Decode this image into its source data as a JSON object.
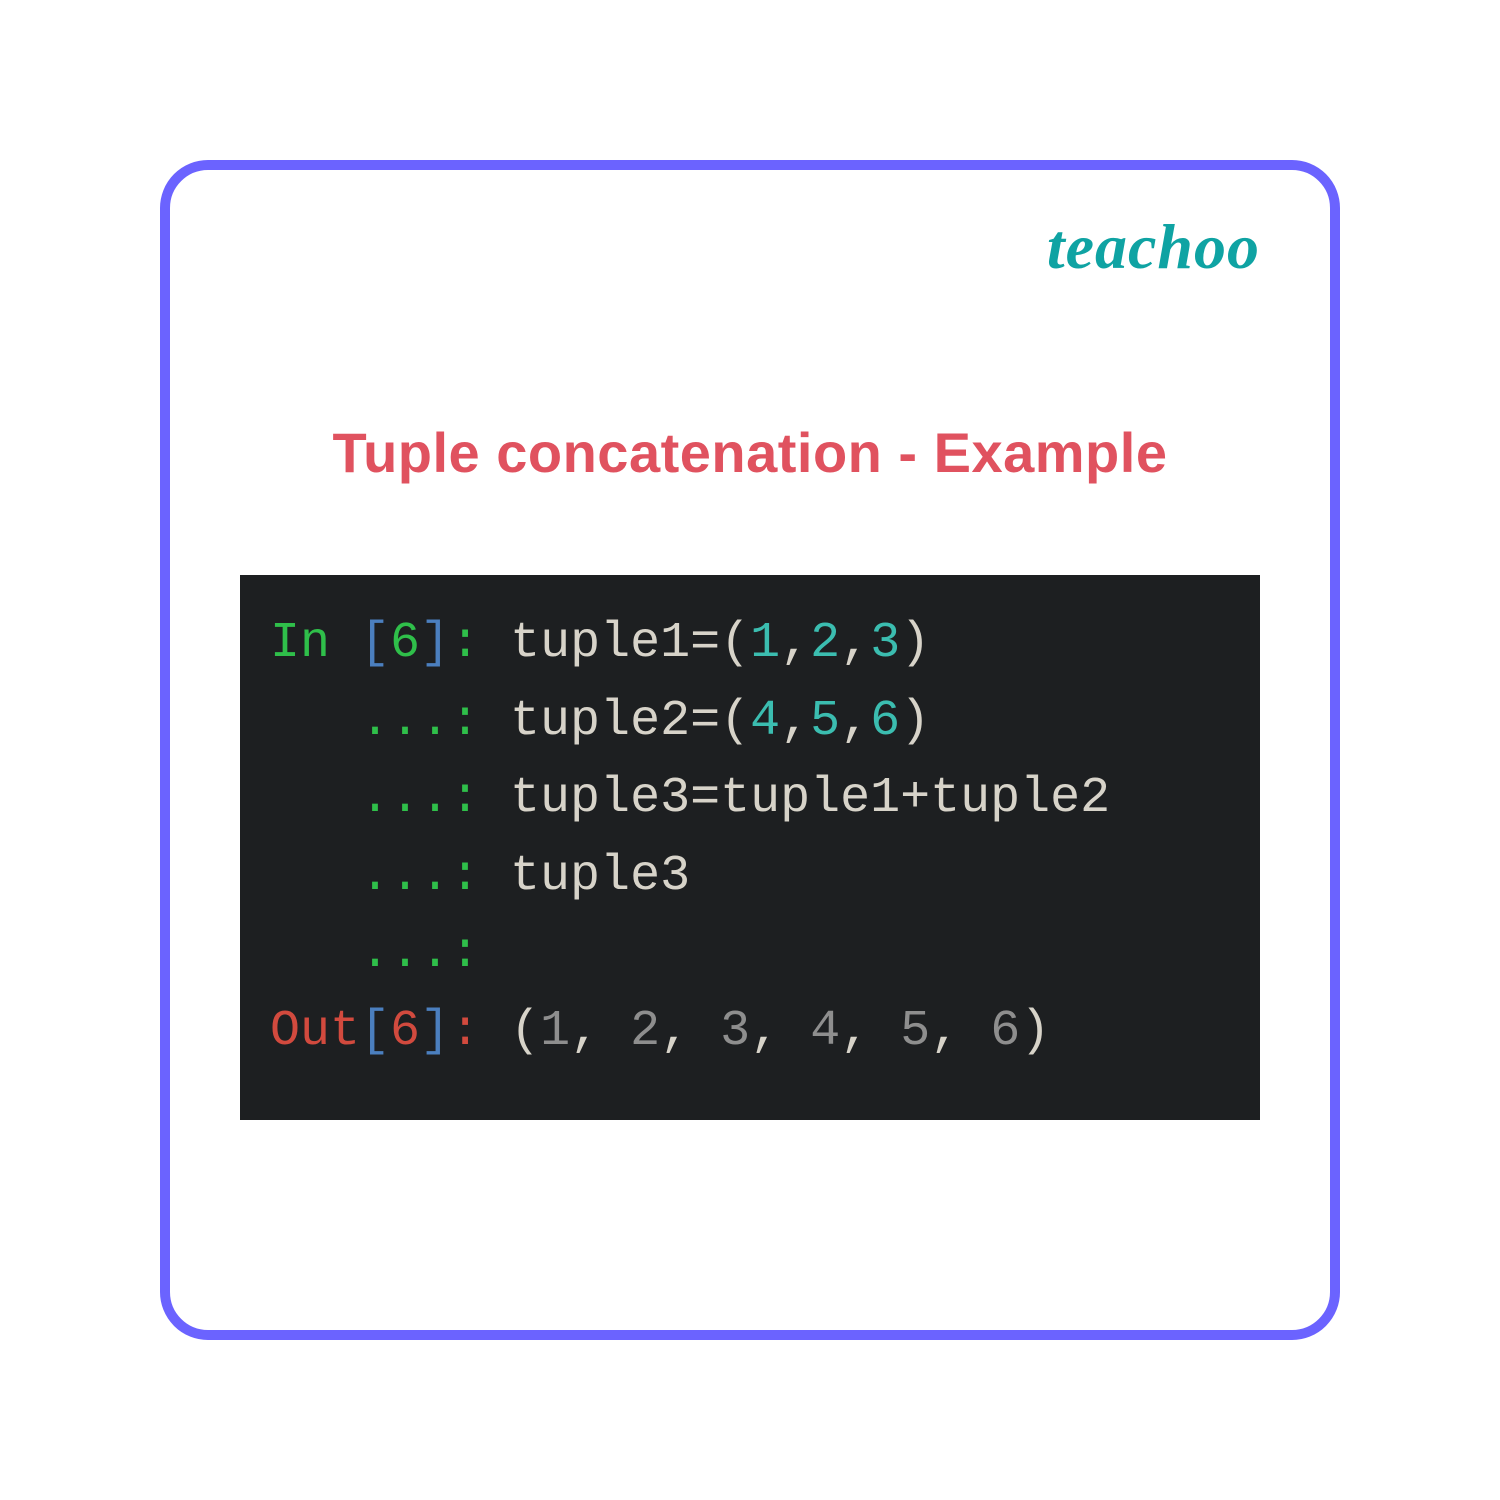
{
  "logo": "teachoo",
  "title": "Tuple concatenation - Example",
  "code": {
    "in_prompt_left": "In ",
    "dots": "   ...",
    "lbrack": "[",
    "rbrack": "]",
    "cell_num": "6",
    "colon_sp": ": ",
    "out_prompt_left": "Out",
    "line1_a": "tuple1=(",
    "line1_n1": "1",
    "line1_c1": ",",
    "line1_n2": "2",
    "line1_c2": ",",
    "line1_n3": "3",
    "line1_b": ")",
    "line2_a": "tuple2=(",
    "line2_n1": "4",
    "line2_c1": ",",
    "line2_n2": "5",
    "line2_c2": ",",
    "line2_n3": "6",
    "line2_b": ")",
    "line3": "tuple3=tuple1+tuple2",
    "line4": "tuple3",
    "out_lp": "(",
    "out_rp": ")",
    "out_n1": "1",
    "out_n2": "2",
    "out_n3": "3",
    "out_n4": "4",
    "out_n5": "5",
    "out_n6": "6",
    "out_cs": ", "
  }
}
